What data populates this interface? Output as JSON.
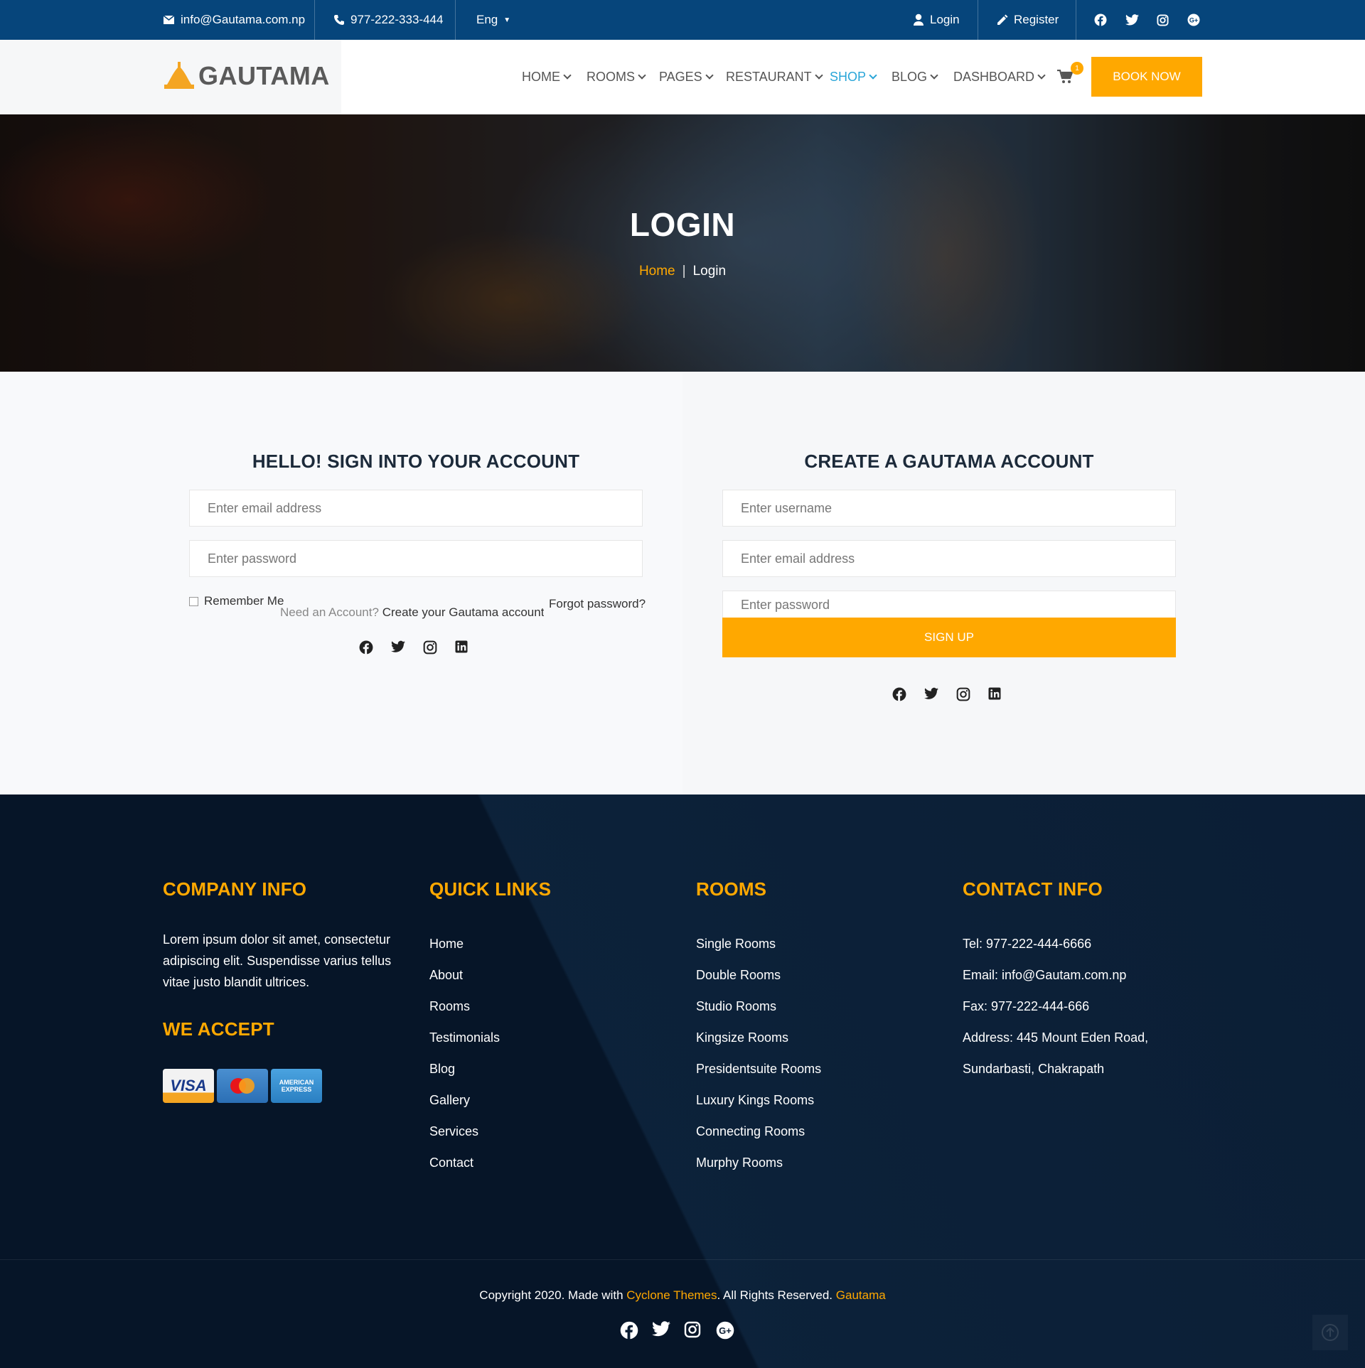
{
  "topbar": {
    "email": "info@Gautama.com.np",
    "phone": "977-222-333-444",
    "language": "Eng",
    "login": "Login",
    "register": "Register"
  },
  "header": {
    "logo_text": "GAUTAMA",
    "nav": [
      {
        "label": "HOME"
      },
      {
        "label": "ROOMS"
      },
      {
        "label": "PAGES"
      },
      {
        "label": "RESTAURANT"
      },
      {
        "label": "SHOP"
      },
      {
        "label": "BLOG"
      },
      {
        "label": "DASHBOARD"
      }
    ],
    "active_nav": "SHOP",
    "cart_count": "1",
    "book_now": "BOOK NOW"
  },
  "hero": {
    "title": "LOGIN",
    "breadcrumb_home": "Home",
    "breadcrumb_separator": "|",
    "breadcrumb_current": "Login"
  },
  "login_form": {
    "title": "HELLO! SIGN INTO YOUR ACCOUNT",
    "email_placeholder": "Enter email address",
    "password_placeholder": "Enter password",
    "remember_label": "Remember Me",
    "forgot_label": "Forgot password?",
    "need_account": "Need an Account?",
    "create_link": "Create your Gautama account"
  },
  "signup_form": {
    "title": "CREATE A GAUTAMA ACCOUNT",
    "username_placeholder": "Enter username",
    "email_placeholder": "Enter email address",
    "password_placeholder": "Enter password",
    "button": "SIGN UP"
  },
  "footer": {
    "company_heading": "COMPANY INFO",
    "company_text": "Lorem ipsum dolor sit amet, consectetur adipiscing elit. Suspendisse varius tellus vitae justo blandit ultrices.",
    "accept_heading": "WE ACCEPT",
    "cards": {
      "visa": "VISA",
      "amex": "AMERICAN EXPRESS"
    },
    "quick_heading": "QUICK LINKS",
    "quick_links": [
      "Home",
      "About",
      "Rooms",
      "Testimonials",
      "Blog",
      "Gallery",
      "Services",
      "Contact"
    ],
    "rooms_heading": "ROOMS",
    "rooms": [
      "Single Rooms",
      "Double Rooms",
      "Studio Rooms",
      "Kingsize Rooms",
      "Presidentsuite Rooms",
      "Luxury Kings Rooms",
      "Connecting Rooms",
      "Murphy Rooms"
    ],
    "contact_heading": "CONTACT INFO",
    "contact": [
      "Tel: 977-222-444-6666",
      "Email: info@Gautam.com.np",
      "Fax: 977-222-444-666",
      "Address: 445 Mount Eden Road,",
      "Sundarbasti, Chakrapath"
    ],
    "copyright_prefix": "Copyright 2020. Made with",
    "copyright_link": "Cyclone Themes",
    "copyright_middle": ". All Rights Reserved.",
    "copyright_brand": "Gautama"
  },
  "colors": {
    "topbar": "#06457b",
    "accent": "#ffa800",
    "active_nav": "#29a5d8",
    "footer": "#061528"
  }
}
